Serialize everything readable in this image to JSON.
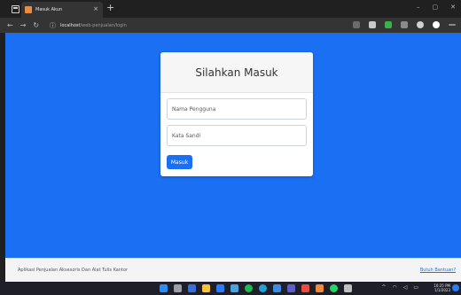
{
  "browser": {
    "tab_title": "Masuk Akun",
    "tab_close": "×",
    "new_tab": "+",
    "url_host": "localhost",
    "url_path": "/web-penjualan/login",
    "nav_back": "←",
    "nav_forward": "→",
    "nav_refresh": "↻",
    "window_controls": [
      "–",
      "▢",
      "✕"
    ]
  },
  "login": {
    "title": "Silahkan Masuk",
    "username_placeholder": "Nama Pengguna",
    "password_placeholder": "Kata Sandi",
    "submit_label": "Masuk"
  },
  "footer": {
    "text": "Aplikasi Penjualan Aksesoris Dan Alat Tulis Kantor",
    "link": "Butuh Bantuan?"
  },
  "taskbar": {
    "time": "10:25 PM",
    "date": "1/1/2023"
  },
  "colors": {
    "page_background": "#1a6ff3",
    "button": "#1a6ff3",
    "link": "#1a6ff3"
  }
}
